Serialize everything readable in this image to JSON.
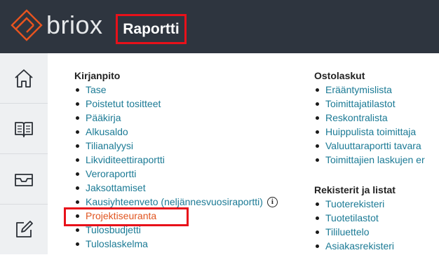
{
  "header": {
    "logo_text": "briox",
    "page_title": "Raportti"
  },
  "sidebar": {
    "items": [
      {
        "icon": "home-icon"
      },
      {
        "icon": "book-icon"
      },
      {
        "icon": "inbox-icon"
      },
      {
        "icon": "edit-icon"
      }
    ]
  },
  "sections": {
    "kirjanpito": {
      "title": "Kirjanpito",
      "items": [
        "Tase",
        "Poistetut tositteet",
        "Pääkirja",
        "Alkusaldo",
        "Tilianalyysi",
        "Likviditeettiraportti",
        "Veroraportti",
        "Jaksottamiset",
        "Kausiyhteenveto (neljännesvuosiraportti)",
        "Projektiseuranta",
        "Tulosbudjetti",
        "Tuloslaskelma"
      ],
      "info_icon_glyph": "i"
    },
    "ostolaskut": {
      "title": "Ostolaskut",
      "items": [
        "Erääntymislista",
        "Toimittajatilastot",
        "Reskontralista",
        "Huippulista toimittaja",
        "Valuuttaraportti tavara",
        "Toimittajien laskujen er"
      ]
    },
    "rekisterit": {
      "title": "Rekisterit ja listat",
      "items": [
        "Tuoterekisteri",
        "Tuotetilastot",
        "Tililuettelo",
        "Asiakasrekisteri"
      ]
    }
  },
  "colors": {
    "header_bg": "#2e353f",
    "link": "#1b7a95",
    "active_link": "#e0541f",
    "highlight": "#e8111a"
  }
}
